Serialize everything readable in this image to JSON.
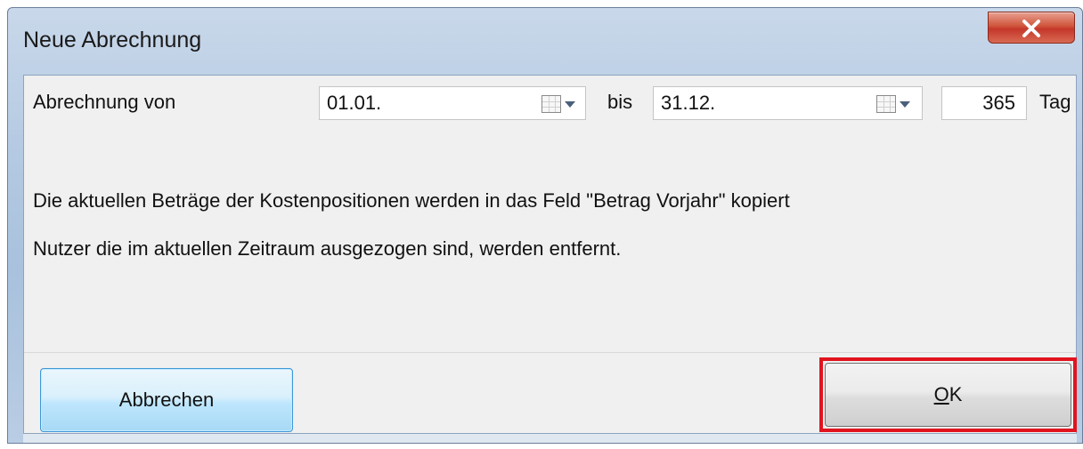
{
  "window": {
    "title": "Neue Abrechnung",
    "close_label": "X"
  },
  "period": {
    "label": "Abrechnung von",
    "from_value": "01.01.",
    "to_label": "bis",
    "to_value": "31.12.",
    "days_value": "365",
    "days_unit": "Tag"
  },
  "info": {
    "line1": "Die aktuellen Beträge der Kostenpositionen werden in das Feld \"Betrag Vorjahr\" kopiert",
    "line2": "Nutzer die im aktuellen Zeitraum ausgezogen sind, werden entfernt."
  },
  "buttons": {
    "cancel_label": "Abbrechen",
    "ok_mnemonic": "O",
    "ok_rest": "K"
  },
  "colors": {
    "highlight": "#e0141e",
    "close_button": "#c4372a",
    "focus_border": "#3c97d8"
  }
}
